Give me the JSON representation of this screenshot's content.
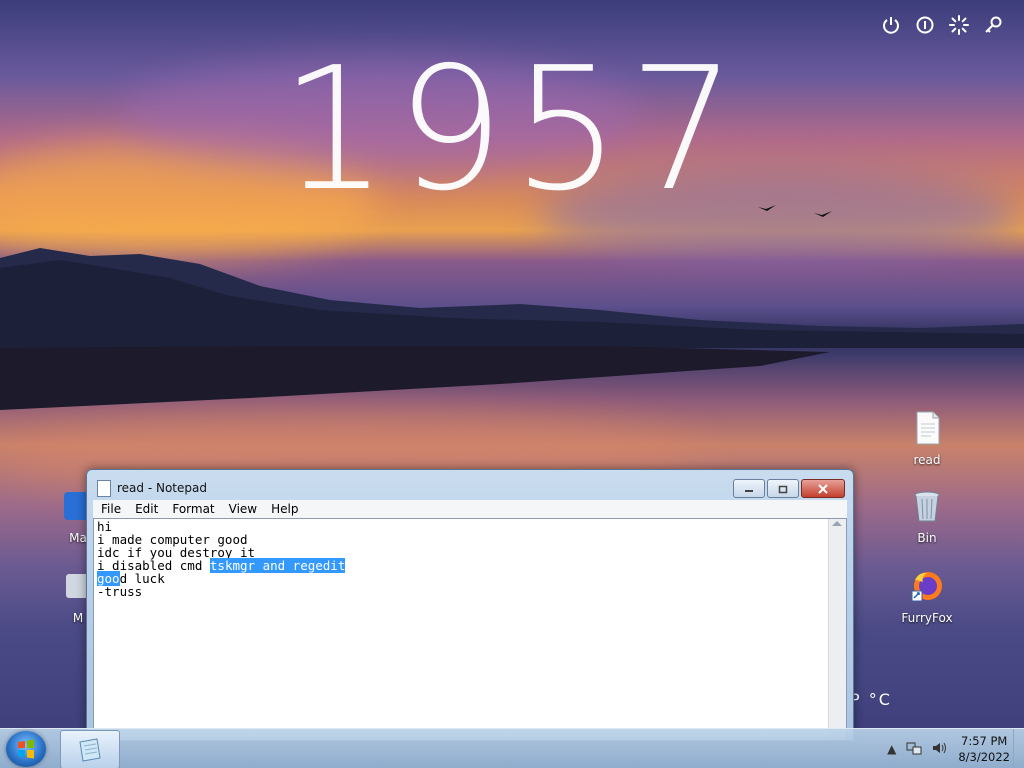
{
  "wallpaper": {
    "clock": "1957"
  },
  "top_actions": [
    {
      "icon": "power-icon"
    },
    {
      "icon": "info-icon"
    },
    {
      "icon": "loading-icon"
    },
    {
      "icon": "key-icon"
    }
  ],
  "desktop_icons": {
    "read": "read",
    "bin": "Bin",
    "furryfox": "FurryFox",
    "left_partial_1": "Ma",
    "left_partial_2": "M"
  },
  "weather": {
    "text": "P  °C"
  },
  "notepad": {
    "title": "read - Notepad",
    "menu": [
      "File",
      "Edit",
      "Format",
      "View",
      "Help"
    ],
    "lines": {
      "l1": "hi",
      "l2": "i made computer good",
      "l3": "idc if you destroy it",
      "l4_plain": "i disabled cmd ",
      "l4_sel": "tskmgr and regedit",
      "l5_sel": "goo",
      "l5_plain": "d luck",
      "l6": "",
      "l7": "-truss"
    }
  },
  "taskbar": {
    "time": "7:57 PM",
    "date": "8/3/2022"
  },
  "colors": {
    "selection": "#3399ff",
    "taskbar": "#a9c4e2"
  }
}
